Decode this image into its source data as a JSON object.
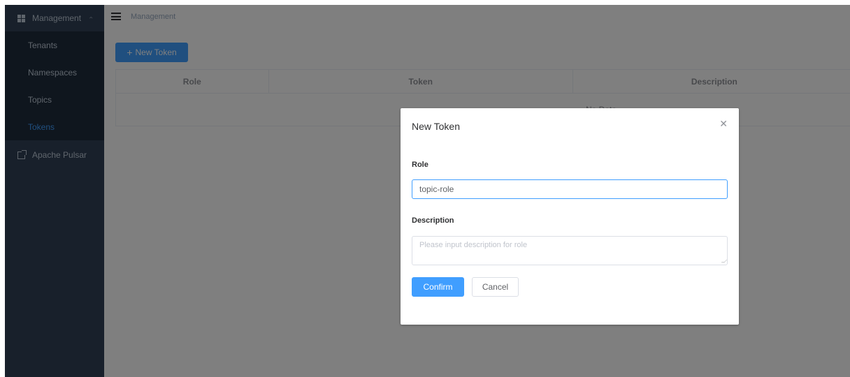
{
  "sidebar": {
    "group_label": "Management",
    "group_icon": "grid-icon",
    "group_chevron_icon": "chevron-up-icon",
    "items": [
      {
        "label": "Tenants",
        "active": false
      },
      {
        "label": "Namespaces",
        "active": false
      },
      {
        "label": "Topics",
        "active": false
      },
      {
        "label": "Tokens",
        "active": true
      }
    ],
    "external_link": {
      "label": "Apache Pulsar",
      "icon": "external-link-icon"
    }
  },
  "navbar": {
    "menu_icon": "hamburger-icon",
    "breadcrumb": "Management"
  },
  "toolbar": {
    "new_token_label": "New Token",
    "new_token_icon": "plus-icon"
  },
  "table": {
    "columns": [
      "Role",
      "Token",
      "Description"
    ],
    "empty_text": "No Data"
  },
  "dialog": {
    "title": "New Token",
    "close_icon": "close-icon",
    "role_label": "Role",
    "role_value": "topic-role",
    "description_label": "Description",
    "description_placeholder": "Please input description for role",
    "description_value": "",
    "confirm_label": "Confirm",
    "cancel_label": "Cancel"
  },
  "colors": {
    "sidebar_bg": "#304156",
    "submenu_bg": "#1f2d3d",
    "accent": "#409eff",
    "overlay": "rgba(0,0,0,0.5)"
  }
}
